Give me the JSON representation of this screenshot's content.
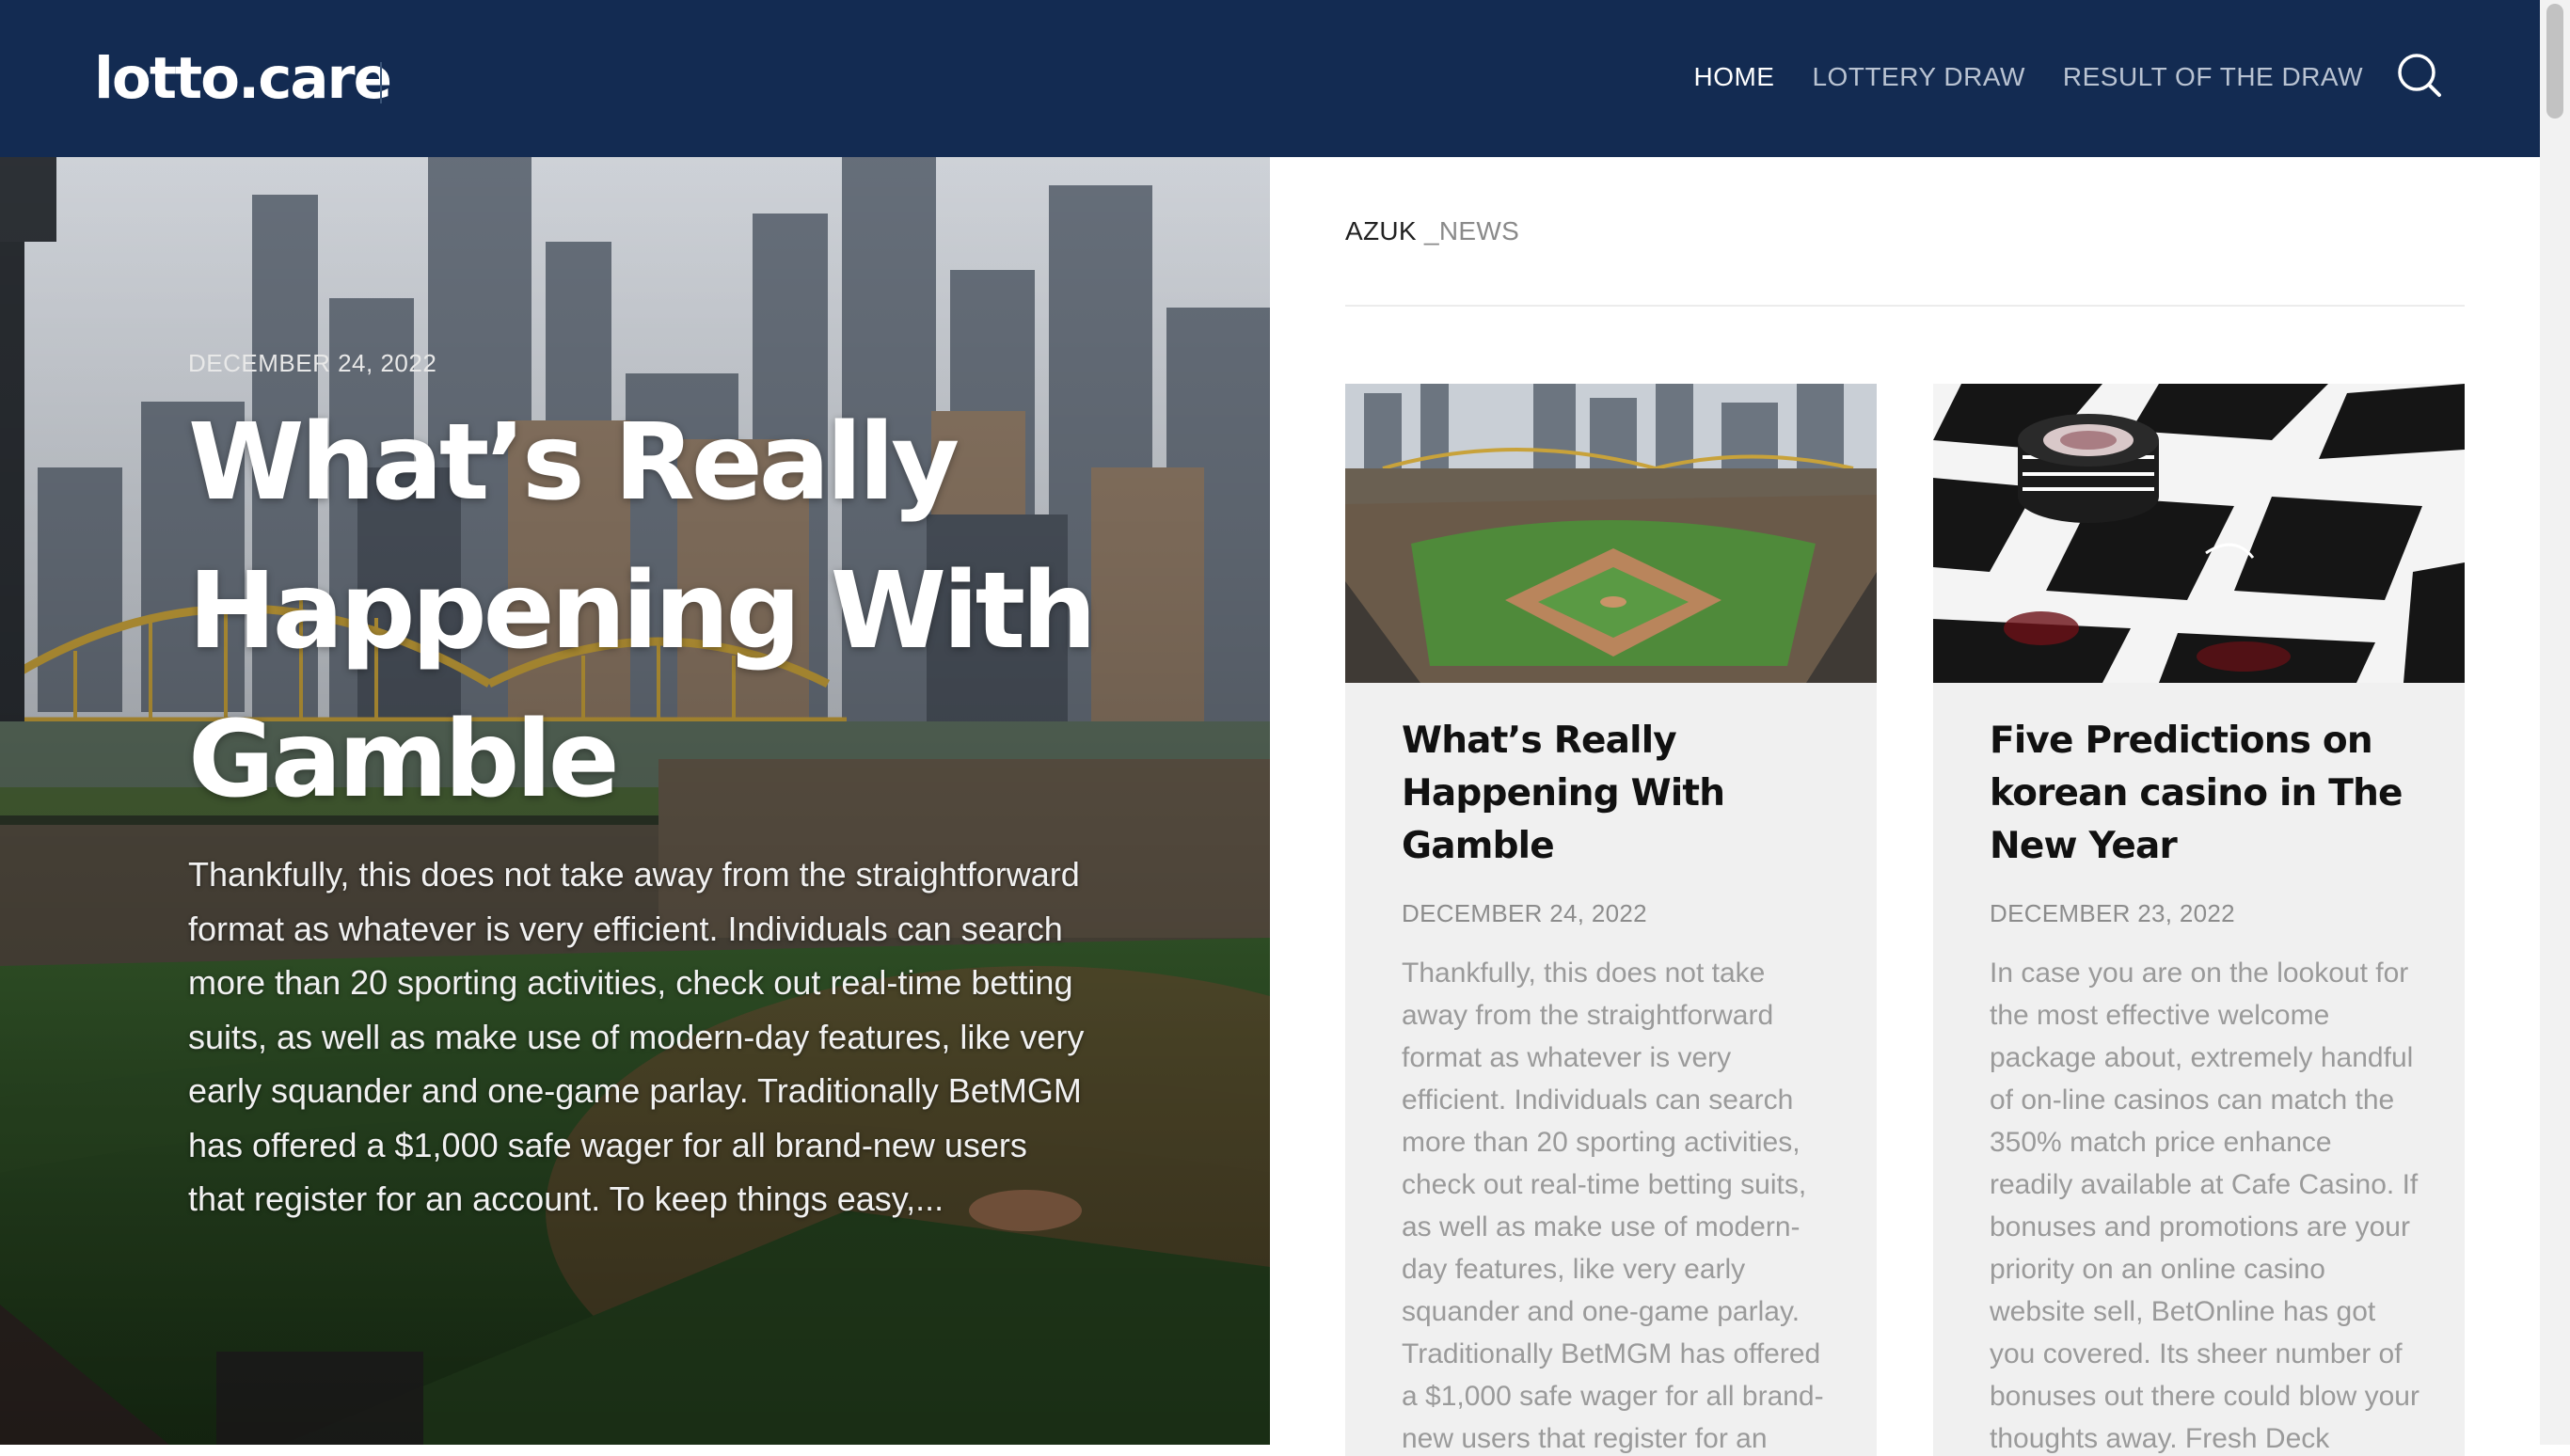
{
  "header": {
    "logo": "lotto.care",
    "nav": [
      {
        "label": "HOME",
        "active": true
      },
      {
        "label": "LOTTERY DRAW",
        "active": false
      },
      {
        "label": "RESULT OF THE DRAW",
        "active": false
      }
    ],
    "search_icon": "search-icon",
    "background": "#132b52"
  },
  "hero": {
    "date": "DECEMBER 24, 2022",
    "title": "What’s Really Happening With Gamble",
    "excerpt": "Thankfully, this does not take away from the straightforward format as whatever is very efficient. Individuals can search more than 20 sporting activities, check out real-time betting suits, as well as make use of modern-day features, like very early squander and one-game parlay. Traditionally BetMGM has offered a $1,000 safe wager for all brand-new users that register for an account. To keep things easy,..."
  },
  "section": {
    "crumb_primary": "AZUK",
    "crumb_secondary": " _NEWS"
  },
  "cards": [
    {
      "title": "What’s Really Happening With Gamble",
      "date": "DECEMBER 24, 2022",
      "excerpt": "Thankfully, this does not take away from the straightforward format as whatever is very efficient. Individuals can search more than 20 sporting activities, check out real-time betting suits, as well as make use of modern-day features, like very early squander and one-game parlay. Traditionally BetMGM has offered a $1,000 safe wager for all brand-new users that register for an account. To keep things easy,..."
    },
    {
      "title": "Five Predictions on korean casino in The New Year",
      "date": "DECEMBER 23, 2022",
      "excerpt": "In case you are on the lookout for the most effective welcome package about, extremely handful of on-line casinos can match the 350% match price enhance readily available at Cafe Casino. If bonuses and promotions are your priority on an online casino website sell, BetOnline has got you covered. Its sheer number of bonuses out there could blow your thoughts away. Fresh Deck"
    }
  ]
}
